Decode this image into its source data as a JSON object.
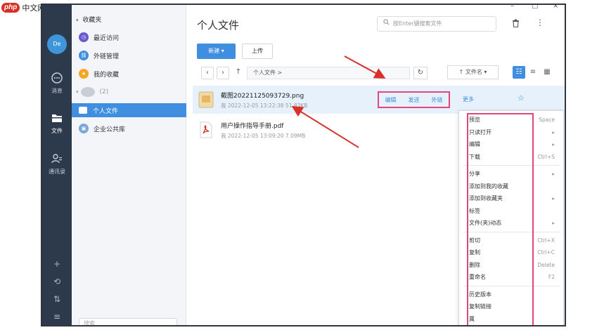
{
  "watermark": {
    "logo": "php",
    "text": "中文网"
  },
  "window": {
    "min_glyph": "–",
    "max_glyph": "□",
    "close_glyph": "×"
  },
  "rail": {
    "avatar": "De",
    "items": [
      {
        "label": "消息",
        "icon": "chat-icon"
      },
      {
        "label": "文件",
        "icon": "folder-icon"
      },
      {
        "label": "通讯录",
        "icon": "contacts-icon"
      }
    ],
    "bottom_icons": [
      "plus-icon",
      "sync-icon",
      "transfer-icon",
      "menu-icon"
    ],
    "bottom_glyphs": [
      "+",
      "⟲",
      "⇅",
      "≡"
    ]
  },
  "sidebar": {
    "group_title": "收藏夹",
    "items": [
      {
        "label": "最近访问",
        "color": "#6a5acd",
        "glyph": "◷"
      },
      {
        "label": "外链管理",
        "color": "#3f8ee0",
        "glyph": "⛓"
      },
      {
        "label": "我的收藏",
        "color": "#f5a623",
        "glyph": "★"
      }
    ],
    "collapsed_group": "(2)",
    "libraries": [
      {
        "label": "个人文件",
        "active": true
      },
      {
        "label": "企业公共库",
        "active": false
      }
    ],
    "search_placeholder": "搜索"
  },
  "main": {
    "title": "个人文件",
    "search_placeholder": "按Enter键搜索文件",
    "new_button": "新建 ▾",
    "upload_button": "上传",
    "path": "个人文件 >",
    "sort_label": "↑ 文件名 ▾",
    "files": [
      {
        "name": "截图20221125093729.png",
        "meta": "我  2022-12-05 13:22:38  51.83KB",
        "type": "image"
      },
      {
        "name": "用户操作指导手册.pdf",
        "meta": "我  2022-12-05 13:09:20  7.09MB",
        "type": "pdf"
      }
    ],
    "row_actions": [
      "编辑",
      "发送",
      "外链"
    ],
    "more": "更多"
  },
  "context_menu": [
    {
      "label": "预览",
      "shortcut": "Space"
    },
    {
      "label": "只读打开",
      "shortcut": "▸"
    },
    {
      "label": "编辑",
      "shortcut": "▸"
    },
    {
      "label": "下载",
      "shortcut": "Ctrl+S"
    },
    {
      "sep": true
    },
    {
      "label": "分享",
      "shortcut": "▸"
    },
    {
      "label": "添加到我的收藏",
      "shortcut": ""
    },
    {
      "label": "添加到收藏夹",
      "shortcut": "▸"
    },
    {
      "label": "标签",
      "shortcut": ""
    },
    {
      "label": "文件(夹)动态",
      "shortcut": "▸"
    },
    {
      "sep": true
    },
    {
      "label": "剪切",
      "shortcut": "Ctrl+X"
    },
    {
      "label": "复制",
      "shortcut": "Ctrl+C"
    },
    {
      "label": "删除",
      "shortcut": "Delete"
    },
    {
      "label": "重命名",
      "shortcut": "F2"
    },
    {
      "sep": true
    },
    {
      "label": "历史版本",
      "shortcut": ""
    },
    {
      "label": "复制链接",
      "shortcut": ""
    },
    {
      "label": "属",
      "shortcut": ""
    }
  ],
  "colors": {
    "accent": "#3f8ee0",
    "highlight": "#e0457b",
    "rail": "#2c3a4c"
  }
}
